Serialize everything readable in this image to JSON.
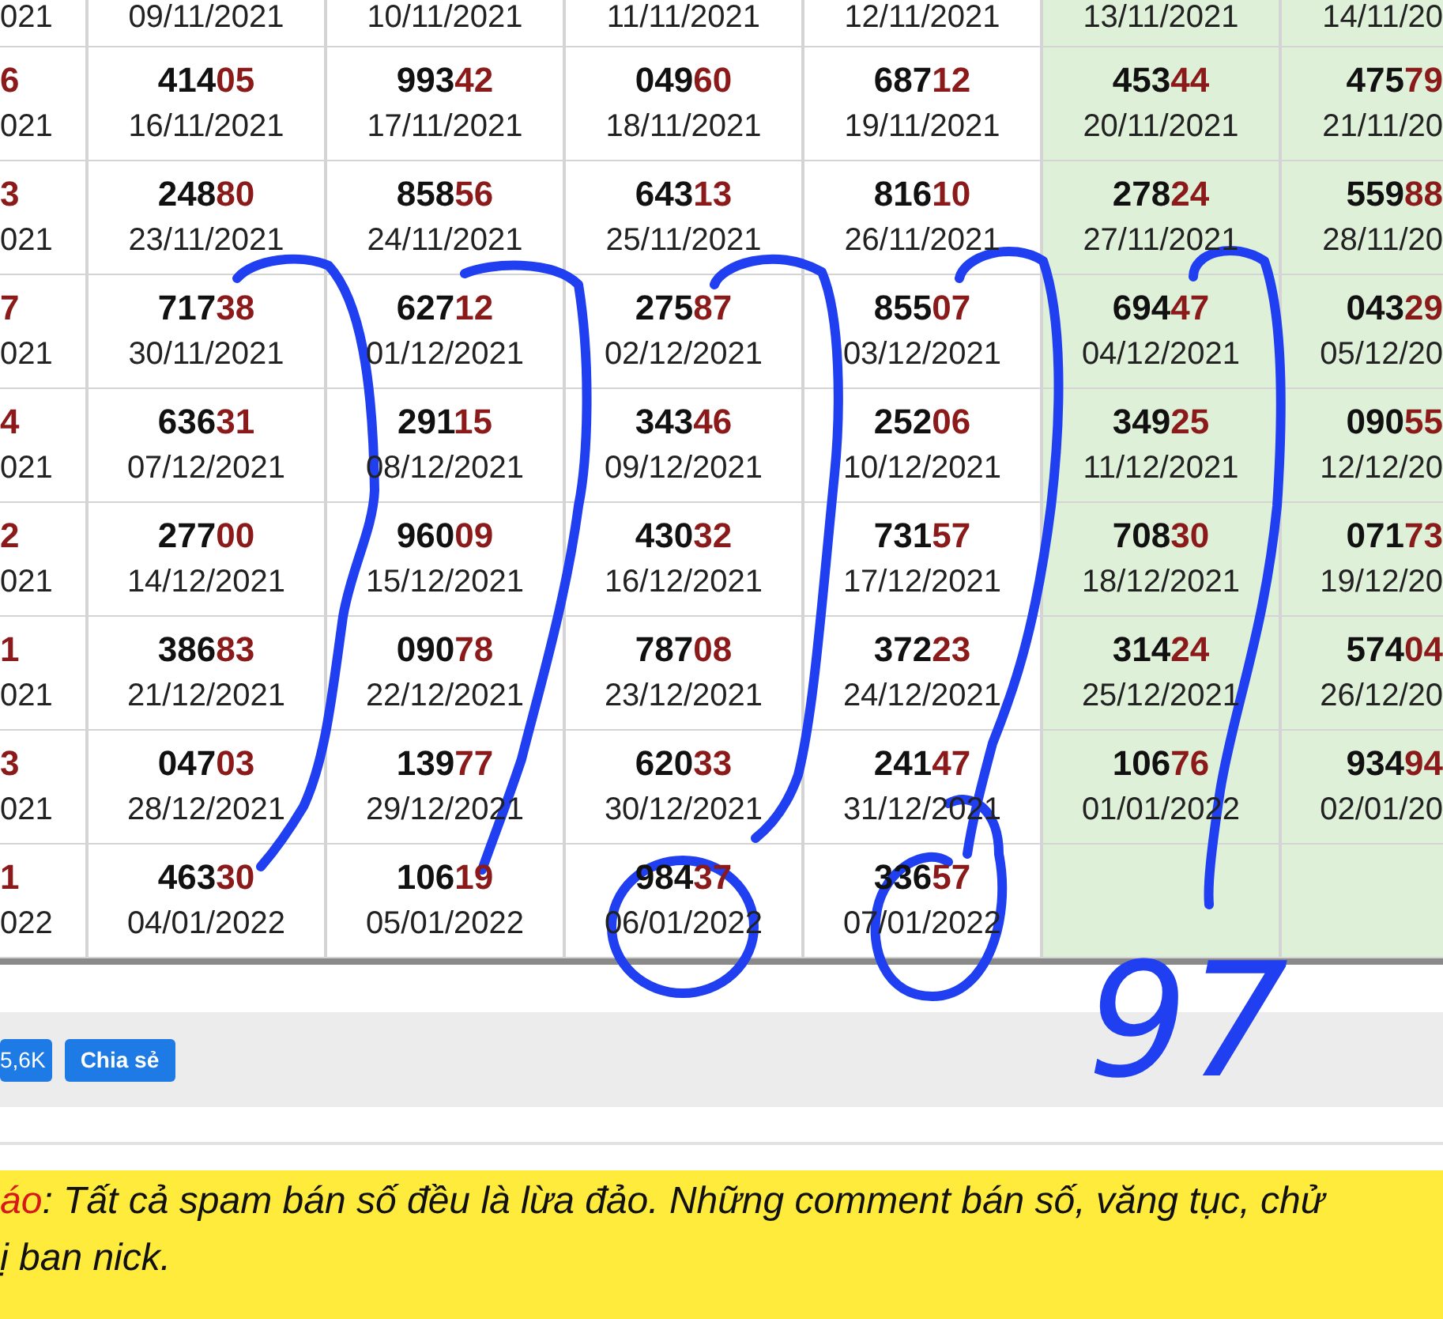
{
  "table": {
    "columns": [
      {
        "highlighted": false
      },
      {
        "highlighted": false
      },
      {
        "highlighted": false
      },
      {
        "highlighted": false
      },
      {
        "highlighted": false
      },
      {
        "highlighted": true
      },
      {
        "highlighted": true
      }
    ],
    "rows": [
      {
        "cells": [
          {
            "date": "021"
          },
          {
            "date": "09/11/2021"
          },
          {
            "date": "10/11/2021"
          },
          {
            "date": "11/11/2021"
          },
          {
            "date": "12/11/2021"
          },
          {
            "date": "13/11/2021"
          },
          {
            "date": "14/11/20"
          }
        ]
      },
      {
        "cells": [
          {
            "number": "6",
            "date": "021"
          },
          {
            "number": "41405",
            "date": "16/11/2021"
          },
          {
            "number": "99342",
            "date": "17/11/2021"
          },
          {
            "number": "04960",
            "date": "18/11/2021"
          },
          {
            "number": "68712",
            "date": "19/11/2021"
          },
          {
            "number": "45344",
            "date": "20/11/2021"
          },
          {
            "number": "47579",
            "date": "21/11/20"
          }
        ]
      },
      {
        "cells": [
          {
            "number": "3",
            "date": "021"
          },
          {
            "number": "24880",
            "date": "23/11/2021"
          },
          {
            "number": "85856",
            "date": "24/11/2021"
          },
          {
            "number": "64313",
            "date": "25/11/2021"
          },
          {
            "number": "81610",
            "date": "26/11/2021"
          },
          {
            "number": "27824",
            "date": "27/11/2021"
          },
          {
            "number": "55988",
            "date": "28/11/20"
          }
        ]
      },
      {
        "cells": [
          {
            "number": "7",
            "date": "021"
          },
          {
            "number": "71738",
            "date": "30/11/2021"
          },
          {
            "number": "62712",
            "date": "01/12/2021"
          },
          {
            "number": "27587",
            "date": "02/12/2021"
          },
          {
            "number": "85507",
            "date": "03/12/2021"
          },
          {
            "number": "69447",
            "date": "04/12/2021"
          },
          {
            "number": "04329",
            "date": "05/12/20"
          }
        ]
      },
      {
        "cells": [
          {
            "number": "4",
            "date": "021"
          },
          {
            "number": "63631",
            "date": "07/12/2021"
          },
          {
            "number": "29115",
            "date": "08/12/2021"
          },
          {
            "number": "34346",
            "date": "09/12/2021"
          },
          {
            "number": "25206",
            "date": "10/12/2021"
          },
          {
            "number": "34925",
            "date": "11/12/2021"
          },
          {
            "number": "09055",
            "date": "12/12/20"
          }
        ]
      },
      {
        "cells": [
          {
            "number": "2",
            "date": "021"
          },
          {
            "number": "27700",
            "date": "14/12/2021"
          },
          {
            "number": "96009",
            "date": "15/12/2021"
          },
          {
            "number": "43032",
            "date": "16/12/2021"
          },
          {
            "number": "73157",
            "date": "17/12/2021"
          },
          {
            "number": "70830",
            "date": "18/12/2021"
          },
          {
            "number": "07173",
            "date": "19/12/20"
          }
        ]
      },
      {
        "cells": [
          {
            "number": "1",
            "date": "021"
          },
          {
            "number": "38683",
            "date": "21/12/2021"
          },
          {
            "number": "09078",
            "date": "22/12/2021"
          },
          {
            "number": "78708",
            "date": "23/12/2021"
          },
          {
            "number": "37223",
            "date": "24/12/2021"
          },
          {
            "number": "31424",
            "date": "25/12/2021"
          },
          {
            "number": "57404",
            "date": "26/12/20"
          }
        ]
      },
      {
        "cells": [
          {
            "number": "3",
            "date": "021"
          },
          {
            "number": "04703",
            "date": "28/12/2021"
          },
          {
            "number": "13977",
            "date": "29/12/2021"
          },
          {
            "number": "62033",
            "date": "30/12/2021"
          },
          {
            "number": "24147",
            "date": "31/12/2021"
          },
          {
            "number": "10676",
            "date": "01/01/2022"
          },
          {
            "number": "93494",
            "date": "02/01/20"
          }
        ]
      },
      {
        "cells": [
          {
            "number": "1",
            "date": "022"
          },
          {
            "number": "46330",
            "date": "04/01/2022"
          },
          {
            "number": "10619",
            "date": "05/01/2022"
          },
          {
            "number": "98437",
            "date": "06/01/2022"
          },
          {
            "number": "33657",
            "date": "07/01/2022"
          }
        ]
      }
    ]
  },
  "annotation": {
    "handwritten_text": "97"
  },
  "actions": [
    {
      "label": "5,6K"
    },
    {
      "label": "Chia sẻ"
    }
  ],
  "notice": {
    "label": "áo",
    "lines": [
      ": Tất cả spam bán số đều là lừa đảo. Những comment bán số, văng tục, chử",
      "ị ban nick."
    ]
  }
}
